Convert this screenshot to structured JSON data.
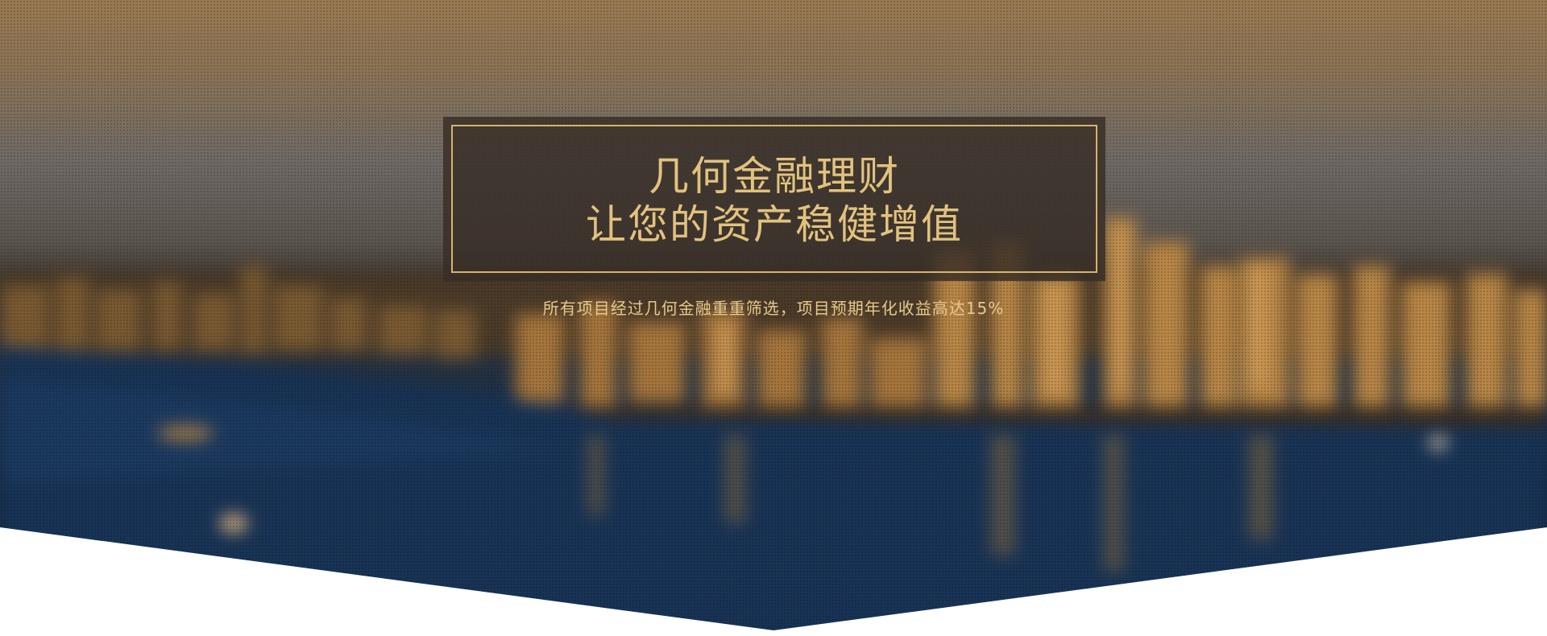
{
  "hero": {
    "title_line1": "几何金融理财",
    "title_line2": "让您的资产稳健增值",
    "subtitle": "所有项目经过几何金融重重筛选，项目预期年化收益高达15%",
    "background_image": "blurred-city-skyline-waterfront",
    "colors": {
      "accent_gold": "#d6b46a",
      "title_text": "#e2c27e",
      "box_background": "#372d26"
    }
  }
}
